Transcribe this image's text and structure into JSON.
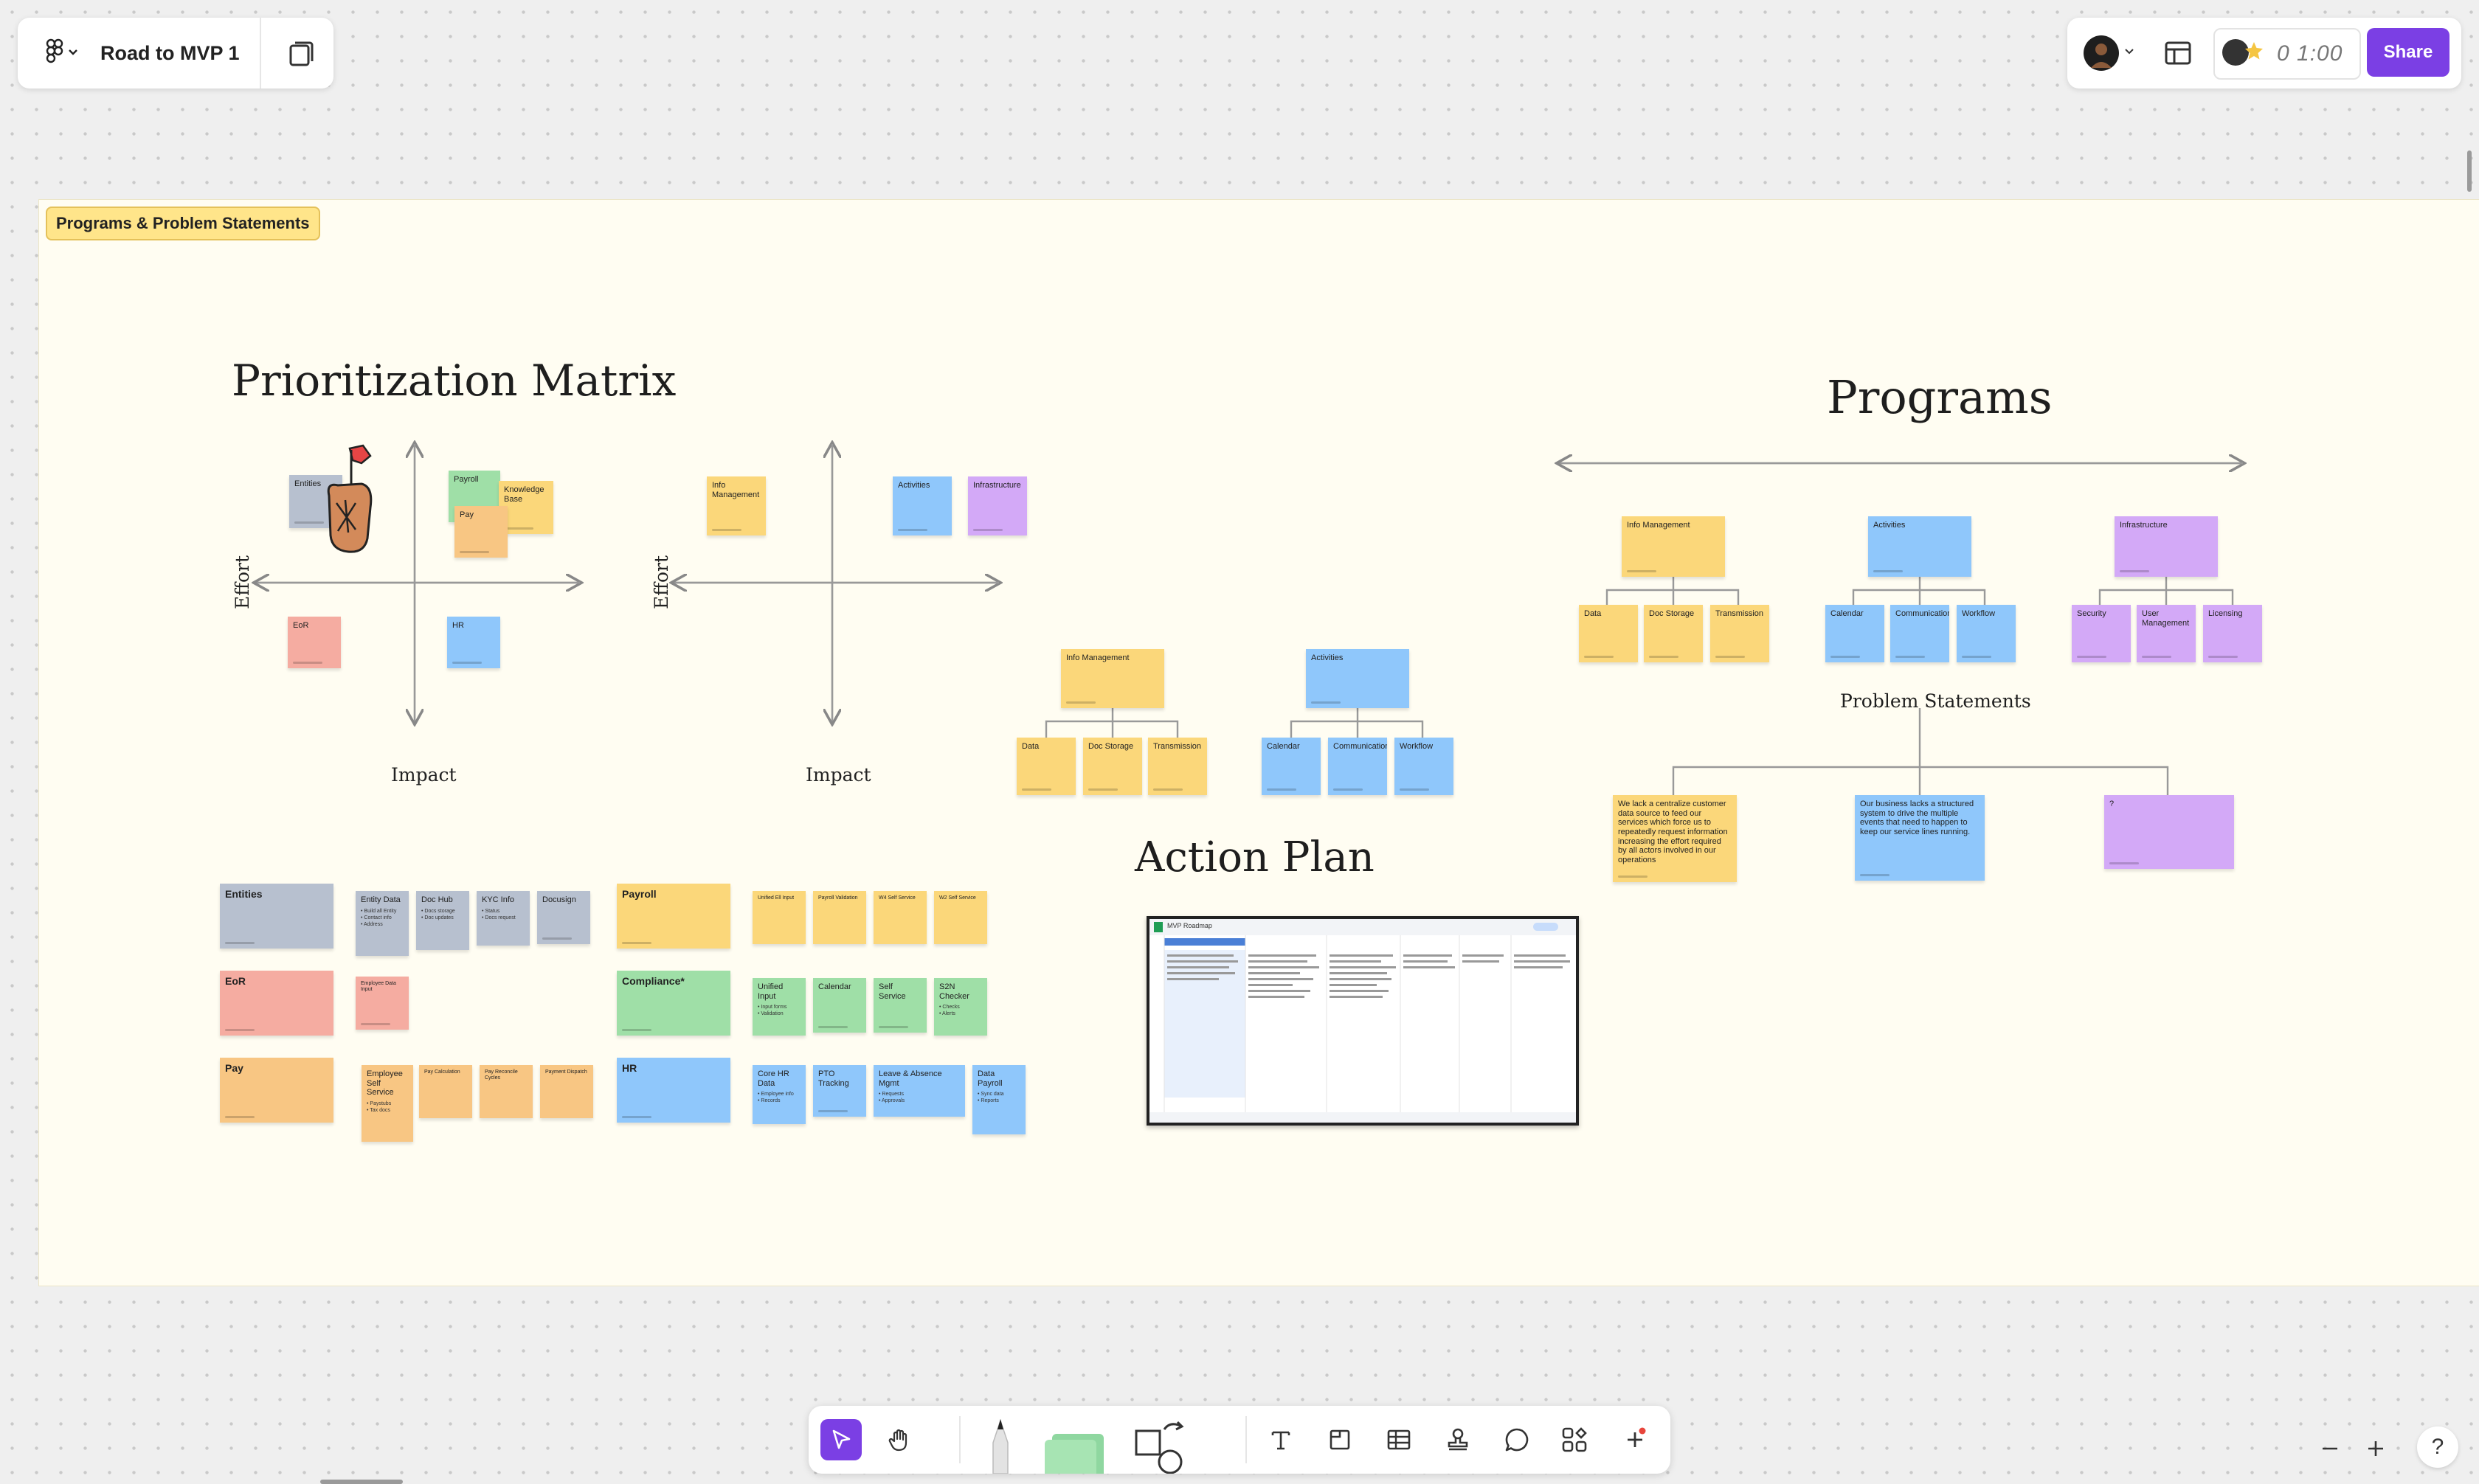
{
  "header": {
    "board_title": "Road to MVP 1",
    "share_label": "Share",
    "timer": "0 1:00"
  },
  "section": {
    "label": "Programs & Problem Statements"
  },
  "headings": {
    "prioritization_matrix": "Prioritization Matrix",
    "programs": "Programs",
    "problem_statements": "Problem Statements",
    "action_plan": "Action Plan"
  },
  "matrix": {
    "effort_label": "Effort",
    "impact_label": "Impact"
  },
  "matrix1": {
    "entities": "Entities",
    "payroll": "Payroll",
    "knowledge_base": "Knowledge Base",
    "pay": "Pay",
    "eor": "EoR",
    "hr": "HR"
  },
  "matrix2": {
    "info_management": "Info Management",
    "activities": "Activities",
    "infrastructure": "Infrastructure"
  },
  "tree_small": {
    "info_management": "Info Management",
    "data": "Data",
    "doc_storage": "Doc Storage",
    "transmission": "Transmission",
    "activities": "Activities",
    "calendar": "Calendar",
    "communication": "Communication",
    "workflow": "Workflow"
  },
  "programs_tree": {
    "info_management": "Info Management",
    "data": "Data",
    "doc_storage": "Doc Storage",
    "transmission": "Transmission",
    "activities": "Activities",
    "calendar": "Calendar",
    "communication": "Communication",
    "workflow": "Workflow",
    "infrastructure": "Infrastructure",
    "security": "Security",
    "user_management": "User Management",
    "licensing": "Licensing"
  },
  "problem_statements": {
    "ps1": "We lack a centralize customer data source to feed our services which force us to repeatedly request information increasing the effort required by all actors involved in our operations",
    "ps2": "Our business lacks a structured system to drive the multiple events that need to happen to keep our service lines running.",
    "ps3": "?"
  },
  "feature_grid": {
    "entities": "Entities",
    "entity_data": "Entity Data",
    "doc_hub": "Doc Hub",
    "kyc_info": "KYC Info",
    "docusign": "Docusign",
    "eor": "EoR",
    "eor_small": "Employee Data Input",
    "pay": "Pay",
    "employee_self_service": "Employee Self Service",
    "pay_1": "Pay Calculation",
    "pay_2": "Pay Reconcile Cycles",
    "pay_3": "Payment Dispatch",
    "payroll": "Payroll",
    "payroll_1": "Unified Ell Input",
    "payroll_2": "Payroll Validation",
    "payroll_3": "W4 Self Service",
    "payroll_4": "W2 Self Service",
    "compliance": "Compliance*",
    "unified_input": "Unified Input",
    "calendar": "Calendar",
    "self_service": "Self Service",
    "s2n_checker": "S2N Checker",
    "hr": "HR",
    "core_hr_data": "Core HR Data",
    "pto_tracking": "PTO Tracking",
    "leave_absence": "Leave & Absence Mgmt",
    "data_payroll": "Data Payroll"
  },
  "sheet": {
    "title": "MVP Roadmap"
  },
  "colors": {
    "accent": "#7b3fe4",
    "yellow": "#fbd77a",
    "blue": "#8fc7fb",
    "purple": "#d3a9f7",
    "green": "#9fdfa7",
    "orange": "#f8c683",
    "red": "#f5aca1",
    "gray": "#b7c0cf",
    "section_bg": "#fffdf2"
  },
  "icons": {
    "logo": "figma-logo-icon",
    "pages": "pages-icon",
    "layout": "layout-icon",
    "move": "move-select-icon",
    "hand": "hand-icon",
    "marker": "marker-icon",
    "sticky": "sticky-note-icon",
    "shape": "shape-icon",
    "connector": "connector-icon",
    "text": "text-icon",
    "section": "section-icon",
    "table": "table-icon",
    "stamp": "stamp-icon",
    "comment": "comment-icon",
    "widgets": "widgets-icon",
    "more": "plus-icon",
    "zoom_out": "minus-icon",
    "zoom_in": "plus-icon",
    "help": "help-icon"
  }
}
